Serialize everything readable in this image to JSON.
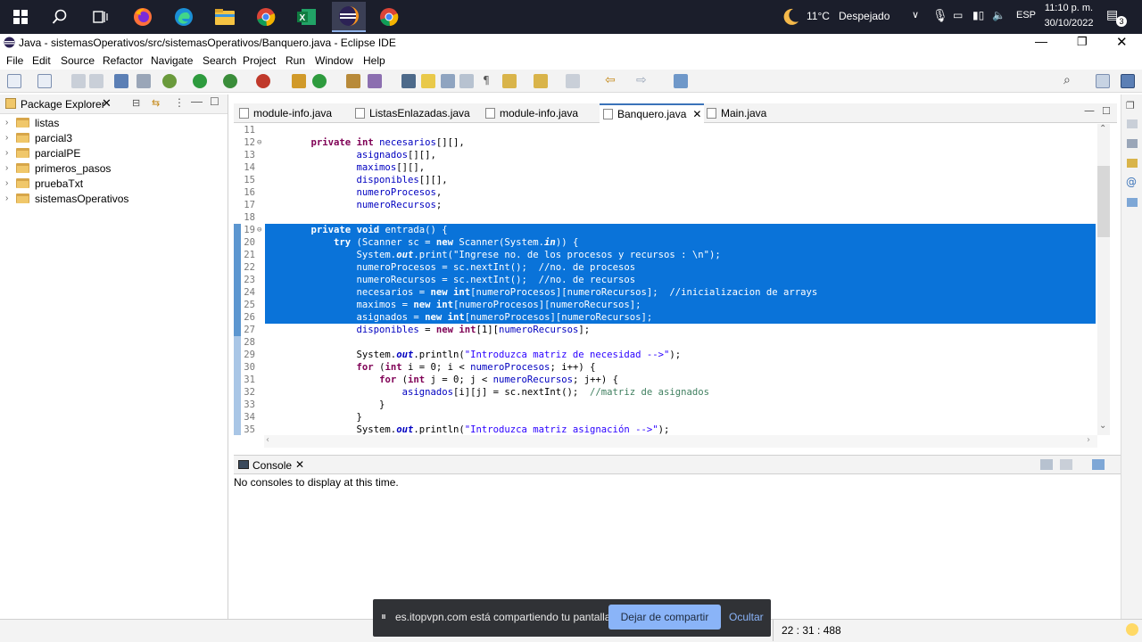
{
  "taskbar": {
    "weather_temp": "11°C",
    "weather_desc": "Despejado",
    "language": "ESP",
    "time": "11:10 p. m.",
    "date": "30/10/2022",
    "notification_count": "3"
  },
  "window": {
    "title": "Java - sistemasOperativos/src/sistemasOperativos/Banquero.java - Eclipse IDE"
  },
  "menu": [
    "File",
    "Edit",
    "Source",
    "Refactor",
    "Navigate",
    "Search",
    "Project",
    "Run",
    "Window",
    "Help"
  ],
  "package_explorer": {
    "title": "Package Explorer",
    "projects": [
      "listas",
      "parcial3",
      "parcialPE",
      "primeros_pasos",
      "pruebaTxt",
      "sistemasOperativos"
    ]
  },
  "editor": {
    "tabs": [
      {
        "label": "module-info.java",
        "active": false
      },
      {
        "label": "ListasEnlazadas.java",
        "active": false
      },
      {
        "label": "module-info.java",
        "active": false
      },
      {
        "label": "Banquero.java",
        "active": true
      },
      {
        "label": "Main.java",
        "active": false
      }
    ]
  },
  "code_lines": [
    {
      "n": "11",
      "html": ""
    },
    {
      "n": "12",
      "fold": "⊖",
      "html": "    <span class='kw'>private</span> <span class='kw'>int</span> <span class='fld'>necesarios</span>[][],"
    },
    {
      "n": "13",
      "html": "            <span class='fld'>asignados</span>[][],"
    },
    {
      "n": "14",
      "html": "            <span class='fld'>maximos</span>[][],"
    },
    {
      "n": "15",
      "html": "            <span class='fld'>disponibles</span>[][],"
    },
    {
      "n": "16",
      "html": "            <span class='fld'>numeroProcesos</span>,"
    },
    {
      "n": "17",
      "html": "            <span class='fld'>numeroRecursos</span>;"
    },
    {
      "n": "18",
      "html": ""
    },
    {
      "n": "19",
      "fold": "⊖",
      "sel": true,
      "html": "    <span class='kw'>private</span> <span class='kw'>void</span> entrada() {"
    },
    {
      "n": "20",
      "sel": true,
      "html": "        <span class='kw'>try</span> (Scanner sc = <span class='kw'>new</span> Scanner(System.<span class='it'>in</span>)) {"
    },
    {
      "n": "21",
      "sel": true,
      "html": "            System.<span class='it'>out</span>.print(<span class='str'>\"Ingrese no. de los procesos y recursos : \\n\"</span>);"
    },
    {
      "n": "22",
      "sel": true,
      "html": "            <span class='fld'>numeroProcesos</span> = sc.nextInt();  <span class='cm'>//no. de procesos</span>"
    },
    {
      "n": "23",
      "sel": true,
      "html": "            <span class='fld'>numeroRecursos</span> = sc.nextInt();  <span class='cm'>//no. de recursos</span>"
    },
    {
      "n": "24",
      "sel": true,
      "html": "            <span class='fld'>necesarios</span> = <span class='kw'>new</span> <span class='kw'>int</span>[<span class='fld'>numeroProcesos</span>][<span class='fld'>numeroRecursos</span>];  <span class='cm'>//inicializacion de arrays</span>"
    },
    {
      "n": "25",
      "sel": true,
      "html": "            <span class='fld'>maximos</span> = <span class='kw'>new</span> <span class='kw'>int</span>[<span class='fld'>numeroProcesos</span>][<span class='fld'>numeroRecursos</span>];"
    },
    {
      "n": "26",
      "sel": true,
      "html": "            <span class='fld'>asignados</span> = <span class='kw'>new</span> <span class='kw'>int</span>[<span class='fld'>numeroProcesos</span>][<span class='fld'>numeroRecursos</span>];"
    },
    {
      "n": "27",
      "html": "            <span class='fld'>disponibles</span> = <span class='kw'>new</span> <span class='kw'>int</span>[1][<span class='fld'>numeroRecursos</span>];"
    },
    {
      "n": "28",
      "html": ""
    },
    {
      "n": "29",
      "html": "            System.<span class='it'>out</span>.println(<span class='str'>\"Introduzca matriz de necesidad --&gt;\"</span>);"
    },
    {
      "n": "30",
      "html": "            <span class='kw'>for</span> (<span class='kw'>int</span> i = 0; i &lt; <span class='fld'>numeroProcesos</span>; i++) {"
    },
    {
      "n": "31",
      "html": "                <span class='kw'>for</span> (<span class='kw'>int</span> j = 0; j &lt; <span class='fld'>numeroRecursos</span>; j++) {"
    },
    {
      "n": "32",
      "html": "                    <span class='fld'>asignados</span>[i][j] = sc.nextInt();  <span class='cm'>//matriz de asignados</span>"
    },
    {
      "n": "33",
      "html": "                }"
    },
    {
      "n": "34",
      "html": "            }"
    },
    {
      "n": "35",
      "html": "            System.<span class='it'>out</span>.println(<span class='str'>\"Introduzca matriz asignación --&gt;\"</span>);"
    }
  ],
  "console": {
    "title": "Console",
    "message": "No consoles to display at this time."
  },
  "status": {
    "position": "22 : 31 : 488"
  },
  "share_bar": {
    "message": "es.itopvpn.com está compartiendo tu pantalla.",
    "stop_label": "Dejar de compartir",
    "hide_label": "Ocultar"
  },
  "colors": {
    "selection": "#0a73d9",
    "keyword": "#7f0055",
    "string": "#2a00ff",
    "comment": "#3f7f5f",
    "field": "#0000c0"
  }
}
